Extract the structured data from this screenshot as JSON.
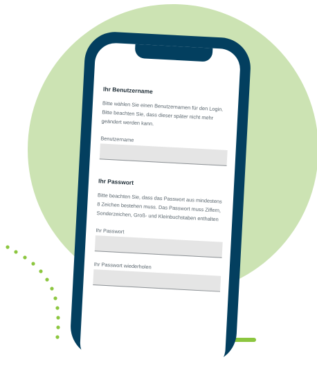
{
  "username_section": {
    "title": "Ihr Benutzername",
    "description": "Bitte wählen Sie einen Benutzernamen für den Login. Bitte beachten Sie, dass dieser später nicht mehr geändert werden kann.",
    "field_label": "Benutzername",
    "field_value": ""
  },
  "password_section": {
    "title": "Ihr Passwort",
    "description": "Bitte beachten Sie, dass das Passwort aus mindestens 8 Zeichen bestehen muss. Das Passwort muss Ziffern, Sonderzeichen, Groß- und Kleinbuchstaben enthalten",
    "password_label": "Ihr Passwort",
    "password_value": "",
    "repeat_label": "Ihr Passwort wiederholen",
    "repeat_value": ""
  },
  "colors": {
    "phone_frame": "#033f5f",
    "background_circle": "#cce3b3",
    "accent_green": "#8cc63f",
    "field_fill": "#e5e5e5"
  }
}
